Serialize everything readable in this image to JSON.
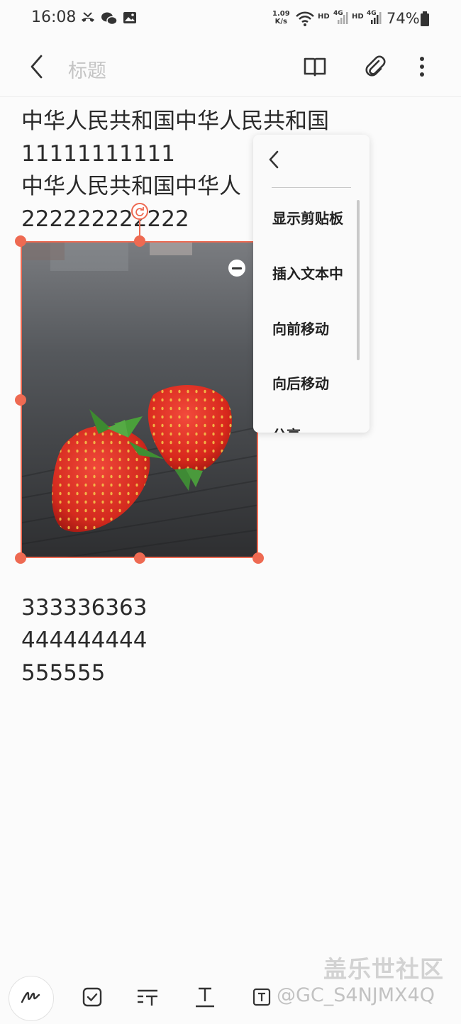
{
  "status_bar": {
    "time": "16:08",
    "speed_value": "1.09",
    "speed_unit": "K/s",
    "hd1": "HD",
    "net1": "4G",
    "hd2": "HD",
    "net2": "4G",
    "battery": "74%",
    "icons": [
      "missed-call-icon",
      "wechat-icon",
      "gallery-icon",
      "wifi-icon",
      "signal-icon",
      "battery-icon"
    ]
  },
  "header": {
    "title_placeholder": "标题",
    "icons": [
      "back-icon",
      "reading-mode-icon",
      "attach-icon",
      "more-icon"
    ]
  },
  "note": {
    "lines_top": [
      "中华人民共和国中华人民共和国",
      "11111111111",
      "中华人民共和国中华人",
      "222222222222"
    ],
    "lines_bottom": [
      "333336363",
      "444444444",
      "555555"
    ]
  },
  "context_menu": {
    "items": [
      "显示剪贴板",
      "插入文本中",
      "向前移动",
      "向后移动",
      "分享"
    ]
  },
  "toolbar": {
    "buttons": [
      "pen-mode-icon",
      "checkbox-icon",
      "text-style-icon",
      "text-format-icon",
      "text-box-icon"
    ]
  },
  "watermark": {
    "brand": "盖乐世社区",
    "user": "@GC_S4NJMX4Q"
  },
  "colors": {
    "accent": "#ee6a52",
    "background": "#fbfbfb"
  }
}
